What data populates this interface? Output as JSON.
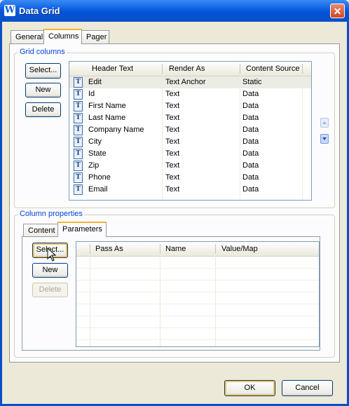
{
  "window": {
    "title": "Data Grid",
    "app_icon": "W",
    "close_glyph": "✕"
  },
  "top_tabs": [
    "General",
    "Columns",
    "Pager"
  ],
  "grid_columns": {
    "label": "Grid columns",
    "buttons": {
      "select": "Select...",
      "new": "New",
      "delete": "Delete"
    },
    "headers": [
      "Header Text",
      "Render As",
      "Content Source"
    ],
    "rows": [
      {
        "icon": "T",
        "header": "Edit",
        "render": "Text Anchor",
        "source": "Static",
        "selected": true
      },
      {
        "icon": "T",
        "header": "Id",
        "render": "Text",
        "source": "Data"
      },
      {
        "icon": "T",
        "header": "First Name",
        "render": "Text",
        "source": "Data"
      },
      {
        "icon": "T",
        "header": "Last Name",
        "render": "Text",
        "source": "Data"
      },
      {
        "icon": "T",
        "header": "Company Name",
        "render": "Text",
        "source": "Data"
      },
      {
        "icon": "T",
        "header": "City",
        "render": "Text",
        "source": "Data"
      },
      {
        "icon": "T",
        "header": "State",
        "render": "Text",
        "source": "Data"
      },
      {
        "icon": "T",
        "header": "Zip",
        "render": "Text",
        "source": "Data"
      },
      {
        "icon": "T",
        "header": "Phone",
        "render": "Text",
        "source": "Data"
      },
      {
        "icon": "T",
        "header": "Email",
        "render": "Text",
        "source": "Data"
      }
    ]
  },
  "column_properties": {
    "label": "Column properties",
    "tabs": [
      "Content",
      "Parameters"
    ],
    "buttons": {
      "select": "Select...",
      "new": "New",
      "delete": "Delete"
    },
    "headers": [
      "Pass As",
      "Name",
      "Value/Map"
    ]
  },
  "footer": {
    "ok": "OK",
    "cancel": "Cancel"
  }
}
